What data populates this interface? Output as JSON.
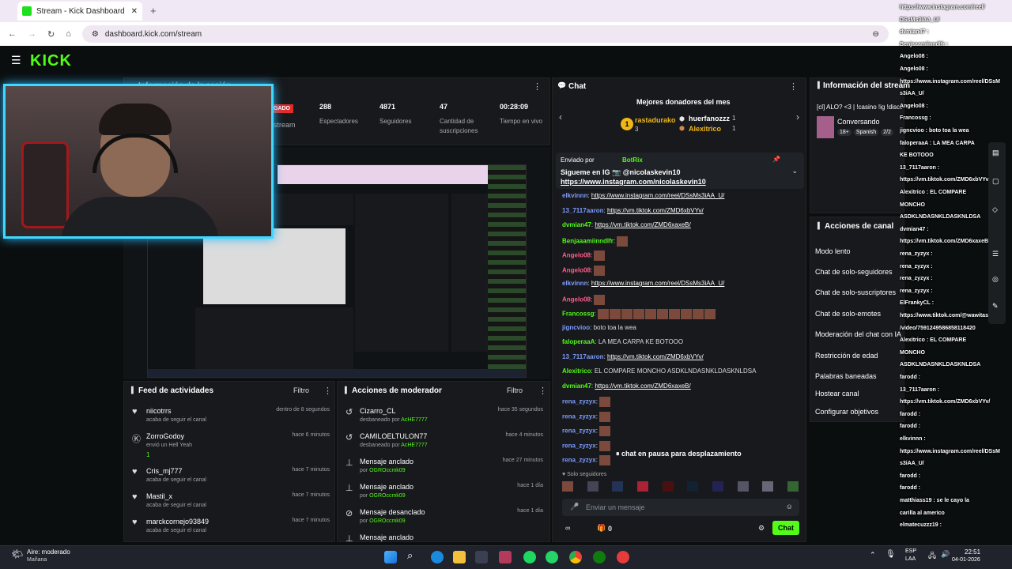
{
  "browser": {
    "tab_title": "Stream - Kick Dashboard",
    "url": "dashboard.kick.com/stream"
  },
  "kick": {
    "logo": "KICK"
  },
  "session": {
    "title": "Información de la sesión",
    "live_badge": "GADO",
    "stream_label": "stream",
    "stats": [
      {
        "value": "288",
        "label": "Espectadores"
      },
      {
        "value": "4871",
        "label": "Seguidores"
      },
      {
        "value": "47",
        "label": "Cantidad de suscripciones"
      },
      {
        "value": "00:28:09",
        "label": "Tiempo en vivo"
      }
    ]
  },
  "feed": {
    "title": "Feed de actividades",
    "filter": "Filtro",
    "items": [
      {
        "icon": "heart-icon",
        "name": "niicotrrs",
        "sub": "acaba de seguir el canal",
        "time": "dentro de 8 segundos"
      },
      {
        "icon": "kick-icon",
        "name": "ZorroGodoy",
        "sub": "envió un Hell Yeah",
        "extra": "1",
        "time": "hace 6 minutos"
      },
      {
        "icon": "heart-icon",
        "name": "Cris_mj777",
        "sub": "acaba de seguir el canal",
        "time": "hace 7 minutos"
      },
      {
        "icon": "heart-icon",
        "name": "Mastil_x",
        "sub": "acaba de seguir el canal",
        "time": "hace 7 minutos"
      },
      {
        "icon": "heart-icon",
        "name": "marckcornejo93849",
        "sub": "acaba de seguir el canal",
        "time": "hace 7 minutos"
      }
    ]
  },
  "modactions": {
    "title": "Acciones de moderador",
    "filter": "Filtro",
    "items": [
      {
        "name": "Cizarro_CL",
        "sub": "desbaneado por",
        "by": "AcHE7777",
        "time": "hace 35 segundos"
      },
      {
        "name": "CAMILOELTULON77",
        "sub": "desbaneado por",
        "by": "AcHE7777",
        "time": "hace 4 minutos"
      },
      {
        "name": "Mensaje anclado",
        "sub": "por",
        "by": "OGROccmk09",
        "time": "hace 27 minutos"
      },
      {
        "name": "Mensaje anclado",
        "sub": "por",
        "by": "OGROccmk09",
        "time": "hace 1 día"
      },
      {
        "name": "Mensaje desanclado",
        "sub": "por",
        "by": "OGROccmk09",
        "time": "hace 1 día"
      },
      {
        "name": "Mensaje anclado",
        "sub": "",
        "by": "",
        "time": ""
      }
    ]
  },
  "chat": {
    "title": "Chat",
    "donors_title": "Mejores donadores del mes",
    "donors": [
      {
        "name": "rastadurako",
        "count": "3"
      },
      {
        "name": "huerfanozzz",
        "count": "1"
      },
      {
        "name": "Alexitrico",
        "count": "1"
      }
    ],
    "pinned_by": "Enviado por",
    "pinned_user": "BotRix",
    "pinned_text": "Sigueme en IG 📷 @nicolaskevin10",
    "pinned_link": "https://www.instagram.com/nicolaskevin10",
    "lines": [
      {
        "user": "elkvinnn",
        "color": "#7e9cff",
        "text": "https://www.instagram.com/reel/DSsMs3iAA_U/"
      },
      {
        "user": "13_7117aaron",
        "color": "#7e9cff",
        "text": "https://vm.tiktok.com/ZMD6xbVYv/"
      },
      {
        "user": "dvmian47",
        "color": "#53fc18",
        "text": "https://vm.tiktok.com/ZMD6xaxeB/"
      },
      {
        "user": "Benjaaamiinndlfr",
        "color": "#53fc18",
        "text": ""
      },
      {
        "user": "Angelo08",
        "color": "#ff5c8a",
        "text": ""
      },
      {
        "user": "Angelo08",
        "color": "#ff5c8a",
        "text": ""
      },
      {
        "user": "elkvinnn",
        "color": "#7e9cff",
        "text": "https://www.instagram.com/reel/DSsMs3iAA_U/"
      },
      {
        "user": "Angelo08",
        "color": "#ff5c8a",
        "text": ""
      },
      {
        "user": "Francossg",
        "color": "#53fc18",
        "text": ""
      },
      {
        "user": "jigncvioo",
        "color": "#7e9cff",
        "text": "boto toa la wea"
      },
      {
        "user": "faloperaaA",
        "color": "#53fc18",
        "text": "LA MEA CARPA KE BOTOOO"
      },
      {
        "user": "13_7117aaron",
        "color": "#7e9cff",
        "text": "https://vm.tiktok.com/ZMD6xbVYv/"
      },
      {
        "user": "Alexitrico",
        "color": "#53fc18",
        "text": "EL COMPARE MONCHO ASDKLNDASNKLDASKNLDSA"
      },
      {
        "user": "dvmian47",
        "color": "#53fc18",
        "text": "https://vm.tiktok.com/ZMD6xaxeB/"
      },
      {
        "user": "rena_zyzyx",
        "color": "#7e9cff",
        "text": ""
      },
      {
        "user": "rena_zyzyx",
        "color": "#7e9cff",
        "text": ""
      },
      {
        "user": "rena_zyzyx",
        "color": "#7e9cff",
        "text": ""
      },
      {
        "user": "rena_zyzyx",
        "color": "#7e9cff",
        "text": ""
      },
      {
        "user": "rena_zyzyx",
        "color": "#7e9cff",
        "text": ""
      }
    ],
    "paused": "chat en pausa para desplazamiento",
    "followers_only": "Solo seguidores",
    "input_placeholder": "Enviar un mensaje",
    "count": "0",
    "send": "Chat"
  },
  "streaminfo": {
    "title": "Información del stream",
    "stream_title": "[cl] ALO? <3 | !casino !ig !discord !merch",
    "category": "Conversando",
    "tags": [
      "18+",
      "Spanish",
      "2/2",
      "BYN1CO",
      "Chile"
    ]
  },
  "channelactions": {
    "title": "Acciones de canal",
    "items": [
      "Modo lento",
      "Chat de solo-seguidores",
      "Chat de solo-suscriptores",
      "Chat de solo-emotes",
      "Moderación del chat con IA",
      "Restricción de edad",
      "Palabras baneadas",
      "Hostear canal",
      "Configurar objetivos"
    ]
  },
  "overlay_chat": [
    "https://www.instagram.com/reel/",
    "DSsMs3iAA_U/",
    "dvmian47 :",
    "Benjaaamiinndlfr :",
    "Angelo08 :",
    "Angelo08 :",
    "https://www.instagram.com/reel/DSsM",
    "s3iAA_U/",
    "Angelo08 :",
    "Francossg :",
    "jigncvioo : boto toa la wea",
    "faloperaaA : LA MEA CARPA",
    "KE BOTOOO",
    "13_7117aaron :",
    "https://vm.tiktok.com/ZMD6xbVYv/",
    "Alexitrico : EL COMPARE",
    "MONCHO",
    "ASDKLNDASNKLDASKNLDSA",
    "dvmian47 :",
    "https://vm.tiktok.com/ZMD6xaxeB/",
    "rena_zyzyx :",
    "rena_zyzyx :",
    "rena_zyzyx :",
    "rena_zyzyx :",
    "ElFrankyCL :",
    "https://www.tiktok.com/@wawitasclips",
    "/video/7591249586858118420",
    "Alexitrico : EL COMPARE",
    "MONCHO",
    "ASDKLNDASNKLDASKNLDSA",
    "farodd :",
    "13_7117aaron :",
    "https://vm.tiktok.com/ZMD6xbVYv/",
    "farodd :",
    "farodd :",
    "elkvinnn :",
    "https://www.instagram.com/reel/DSsM",
    "s3iAA_U/",
    "farodd :",
    "farodd :",
    "matthiass19 : se le cayo la",
    "carilla al americo",
    "elmatecuzzz19 :"
  ],
  "taskbar": {
    "weather": "Aire: moderado",
    "weather_sub": "Mañana",
    "lang": "ESP",
    "lang_sub": "LAA",
    "time": "22:51",
    "date": "04-01-2026"
  }
}
